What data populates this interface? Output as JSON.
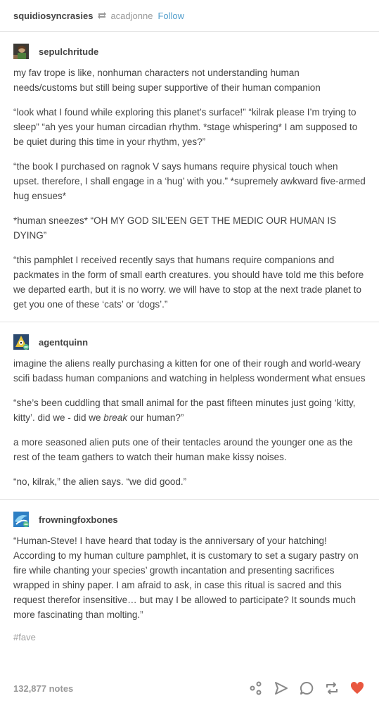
{
  "header": {
    "blog_name": "squidiosyncrasies",
    "reblogged_from": "acadjonne",
    "follow_label": "Follow"
  },
  "posts": [
    {
      "username": "sepulchritude",
      "paragraphs": [
        "my fav trope is like, nonhuman characters not understanding human needs/customs but still being super supportive of their human companion",
        "“look what I found while exploring this planet’s surface!” “kilrak please I’m trying to sleep” “ah yes your human circadian rhythm. *stage whispering* I am supposed to be quiet during this time in your rhythm, yes?”",
        "“the book I purchased on ragnok V says humans require physical touch when upset. therefore, I shall engage in a ‘hug’ with you.” *supremely awkward five-armed hug ensues*",
        "*human sneezes* “OH MY GOD SIL’EEN GET THE MEDIC OUR HUMAN IS DYING”",
        "“this pamphlet I received recently says that humans require companions and packmates in the form of small earth creatures. you should have told me this before we departed earth, but it is no worry. we will have to stop at the next trade planet to get you one of these ‘cats’ or ‘dogs’.”"
      ]
    },
    {
      "username": "agentquinn",
      "paragraphs": [
        "imagine the aliens really purchasing a kitten for one of their rough and world-weary scifi badass human companions and watching in helpless wonderment what ensues",
        {
          "before": "“she’s been cuddling that small animal for the past fifteen minutes just going ‘kitty, kitty’. did we - did we ",
          "em": "break",
          "after": " our human?”"
        },
        "a more seasoned alien puts one of their tentacles around the younger one as the rest of the team gathers to watch their human make kissy noises.",
        "“no, kilrak,” the alien says. “we did good.”"
      ]
    },
    {
      "username": "frowningfoxbones",
      "paragraphs": [
        "“Human-Steve! I have heard that today is the anniversary of your hatching! According to my human culture pamphlet, it is customary to set a sugary pastry on fire while chanting your species’ growth incantation and presenting sacrifices wrapped in shiny paper. I am afraid to ask, in case this ritual is sacred and this request therefor insensitive… but may I be allowed to participate? It sounds much more fascinating than molting.”"
      ]
    }
  ],
  "tags": [
    "#fave"
  ],
  "footer": {
    "notes": "132,877 notes",
    "actions": [
      "share-icon",
      "send-icon",
      "reply-icon",
      "reblog-icon",
      "heart-icon"
    ],
    "like_color": "#e9573f"
  }
}
